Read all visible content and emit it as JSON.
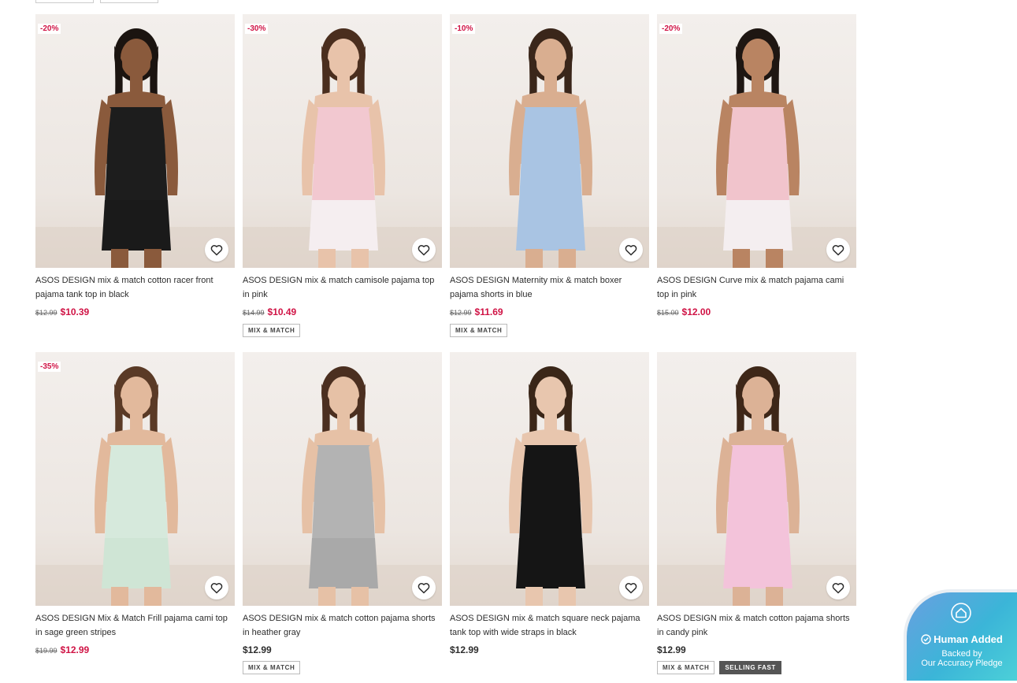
{
  "products": [
    {
      "discount": "-20%",
      "title": "ASOS DESIGN mix & match cotton racer front pajama tank top in black",
      "old_price": "$12.99",
      "price": "$10.39",
      "tags": [],
      "top": "#1d1d1d",
      "bottom": "#1a1a1a",
      "skin": "#8a5a3c",
      "hair": "#1b1410"
    },
    {
      "discount": "-30%",
      "title": "ASOS DESIGN mix & match camisole pajama top in pink",
      "old_price": "$14.99",
      "price": "$10.49",
      "tags": [
        "MIX & MATCH"
      ],
      "top": "#f2c8d0",
      "bottom": "#f5eef0",
      "skin": "#e8c3aa",
      "hair": "#4a2e1e"
    },
    {
      "discount": "-10%",
      "title": "ASOS DESIGN Maternity mix & match boxer pajama shorts in blue",
      "old_price": "$12.99",
      "price": "$11.69",
      "tags": [
        "MIX & MATCH"
      ],
      "top": "#a9c4e3",
      "bottom": "#a9c4e3",
      "skin": "#d9ae90",
      "hair": "#3a261a"
    },
    {
      "discount": "-20%",
      "title": "ASOS DESIGN Curve mix & match pajama cami top in pink",
      "old_price": "$15.00",
      "price": "$12.00",
      "tags": [],
      "top": "#f1c4cc",
      "bottom": "#f4eef0",
      "skin": "#b98462",
      "hair": "#1e1612"
    },
    {
      "discount": "-35%",
      "title": "ASOS DESIGN Mix & Match Frill pajama cami top in sage green stripes",
      "old_price": "$19.99",
      "price": "$12.99",
      "tags": [],
      "top": "#d6e9dc",
      "bottom": "#cfe5d5",
      "skin": "#e2b99c",
      "hair": "#5a3a26"
    },
    {
      "discount": "",
      "title": "ASOS DESIGN mix & match cotton pajama shorts in heather gray",
      "old_price": "",
      "price": "$12.99",
      "tags": [
        "MIX & MATCH"
      ],
      "top": "#b3b3b3",
      "bottom": "#a9a9a9",
      "skin": "#e6c1a6",
      "hair": "#4b2f20"
    },
    {
      "discount": "",
      "title": "ASOS DESIGN mix & match square neck pajama tank top with wide straps in black",
      "old_price": "",
      "price": "$12.99",
      "tags": [],
      "top": "#151515",
      "bottom": "#151515",
      "skin": "#e8c6ae",
      "hair": "#3a2618"
    },
    {
      "discount": "",
      "title": "ASOS DESIGN mix & match cotton pajama shorts in candy pink",
      "old_price": "",
      "price": "$12.99",
      "tags": [
        "MIX & MATCH",
        "SELLING FAST"
      ],
      "top": "#f3c3da",
      "bottom": "#f3c3da",
      "skin": "#dcb296",
      "hair": "#3e2718"
    }
  ],
  "badge": {
    "line1": "Human Added",
    "line2a": "Backed by",
    "line2b": "Our Accuracy Pledge"
  }
}
